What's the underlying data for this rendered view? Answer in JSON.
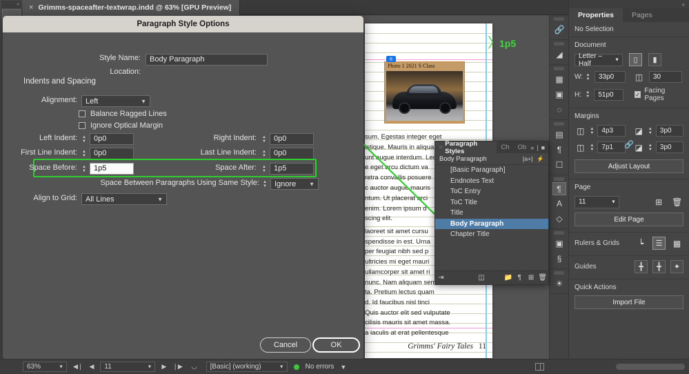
{
  "app": {
    "tab": {
      "title": "Grimms-spaceafter-textwrap.indd @ 63% [GPU Preview]",
      "close_icon": "×"
    },
    "collapse_icon": "»"
  },
  "dialog": {
    "title": "Paragraph Style Options",
    "style_name_label": "Style Name:",
    "style_name_value": "Body Paragraph",
    "location_label": "Location:",
    "section_title": "Indents and Spacing",
    "alignment_label": "Alignment:",
    "alignment_value": "Left",
    "balance_ragged_label": "Balance Ragged Lines",
    "ignore_optical_label": "Ignore Optical Margin",
    "left_indent_label": "Left Indent:",
    "left_indent_value": "0p0",
    "right_indent_label": "Right Indent:",
    "right_indent_value": "0p0",
    "first_line_indent_label": "First Line Indent:",
    "first_line_indent_value": "0p0",
    "last_line_indent_label": "Last Line Indent:",
    "last_line_indent_value": "0p0",
    "space_before_label": "Space Before:",
    "space_before_value": "1p5",
    "space_after_label": "Space After:",
    "space_after_value": "1p5",
    "space_between_label": "Space Between Paragraphs Using Same Style:",
    "space_between_value": "Ignore",
    "align_to_grid_label": "Align to Grid:",
    "align_to_grid_value": "All Lines",
    "cancel_label": "Cancel",
    "ok_label": "OK"
  },
  "annotation": {
    "bracket": "〉",
    "label": "1p5",
    "color": "#3cdb3c"
  },
  "document": {
    "image_caption": "Photo 1 2021 S Class",
    "body_text_1": "sum. Egestas integer eget\nistique. Mauris in aliquam sem\nunt augue interdum. Leo\ne eget arcu dictum va\nretra convallis posuere\nc auctor augue mauris\nntum. Ut placerat orci\nenim. Lorem ipsum d\nscing elit.",
    "body_text_2": "laoreet sit amet cursu\nspendisse in est. Urna\nper feugiat nibh sed p\nultricies mi eget mauri\nullamcorper sit amet ri\nnunc. Nam aliquam sem\nta. Pretium lectus quam\nd. Id faucibus nisl tinci\nQuis auctor elit sed vulputate\ncilisis mauris sit amet massa.\na iaculis at erat pellentesque",
    "folio_title": "Grimms' Fairy Tales",
    "folio_number": "11"
  },
  "paragraph_styles": {
    "panel_title": "Paragraph Styles",
    "tab_ch": "Ch",
    "tab_ob": "Ob",
    "menu_icon": "»",
    "panel_icon": "■",
    "current_style": "Body Paragraph",
    "tag_icon": "[a+]",
    "bolt_icon": "⚡",
    "items": [
      {
        "label": "[Basic Paragraph]",
        "selected": false
      },
      {
        "label": "Endnotes Text",
        "selected": false
      },
      {
        "label": "ToC Entry",
        "selected": false
      },
      {
        "label": "ToC Title",
        "selected": false
      },
      {
        "label": "Title",
        "selected": false
      },
      {
        "label": "Body Paragraph",
        "selected": true
      },
      {
        "label": "Chapter Title",
        "selected": false
      }
    ],
    "footer_icons": [
      "clear-override-icon",
      "new-style-group-icon",
      "folder-icon",
      "load-styles-icon",
      "new-style-icon",
      "delete-icon"
    ]
  },
  "properties": {
    "tab_properties": "Properties",
    "tab_pages": "Pages",
    "selection_state": "No Selection",
    "document_header": "Document",
    "page_size_value": "Letter – Half",
    "w_label": "W:",
    "w_value": "33p0",
    "h_label": "H:",
    "h_value": "51p0",
    "pages_count_value": "30",
    "facing_pages_label": "Facing Pages",
    "margins_header": "Margins",
    "margin_top_value": "4p3",
    "margin_bottom_value": "7p1",
    "margin_left_value": "3p0",
    "margin_right_value": "3p0",
    "adjust_layout_label": "Adjust Layout",
    "page_header": "Page",
    "page_value": "11",
    "edit_page_label": "Edit Page",
    "rulers_grids_header": "Rulers & Grids",
    "guides_header": "Guides",
    "quick_actions_header": "Quick Actions",
    "import_file_label": "Import File"
  },
  "status_bar": {
    "zoom_value": "63%",
    "page_value": "11",
    "preflight_profile": "[Basic] (working)",
    "errors_text": "No errors",
    "first_icon": "◀❘",
    "prev_icon": "◀",
    "next_icon": "▶",
    "last_icon": "❘▶"
  },
  "rail_icons": [
    "links-icon",
    "layers-icon",
    "swatches-icon",
    "gradient-icon",
    "color-icon",
    "paragraph-align-icon",
    "paragraph-icon",
    "object-styles-icon",
    "paragraph-styles-icon",
    "character-styles-icon",
    "object-icon",
    "pages-icon",
    "text-wrap-icon",
    "effects-icon"
  ]
}
